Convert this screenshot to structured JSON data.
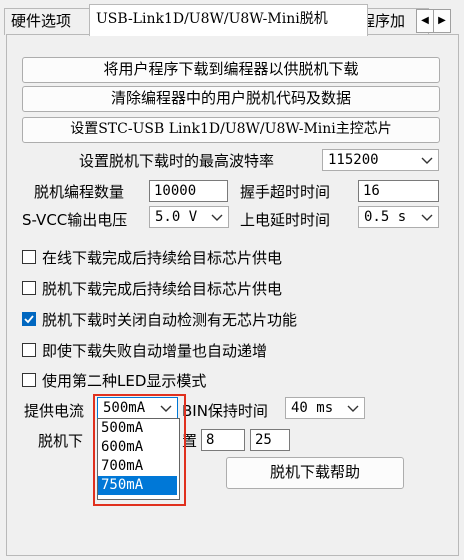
{
  "tabs": [
    {
      "label": "硬件选项"
    },
    {
      "label": "USB-Link1D/U8W/U8W-Mini脱机"
    },
    {
      "label": "程序加"
    }
  ],
  "buttons": {
    "download_to_programmer": "将用户程序下载到编程器以供脱机下载",
    "clear_programmer": "清除编程器中的用户脱机代码及数据",
    "set_master_chip": "设置STC-USB Link1D/U8W/U8W-Mini主控芯片",
    "offline_help": "脱机下载帮助"
  },
  "settings": {
    "max_baud_label": "设置脱机下载时的最高波特率",
    "max_baud_value": "115200",
    "count_label": "脱机编程数量",
    "count_value": "10000",
    "handshake_label": "握手超时时间",
    "handshake_value": "16",
    "svcc_label": "S-VCC输出电压",
    "svcc_value": "5.0 V",
    "poweron_label": "上电延时时间",
    "poweron_value": "0.5 s",
    "current_label": "提供电流",
    "current_value": "500mA",
    "bin_hold_label": "BIN保持时间",
    "bin_hold_value": "40 ms",
    "offline_pos_label_left": "脱机下",
    "offline_pos_label_right": "置",
    "offline_pos_value1": "8",
    "offline_pos_value2": "25"
  },
  "checkboxes": [
    {
      "label": "在线下载完成后持续给目标芯片供电",
      "checked": false
    },
    {
      "label": "脱机下载完成后持续给目标芯片供电",
      "checked": false
    },
    {
      "label": "脱机下载时关闭自动检测有无芯片功能",
      "checked": true
    },
    {
      "label": "即使下载失败自动增量也自动递增",
      "checked": false
    },
    {
      "label": "使用第二种LED显示模式",
      "checked": false
    }
  ],
  "current_options": [
    "500mA",
    "600mA",
    "700mA",
    "750mA"
  ],
  "selected_option_index": 3,
  "colors": {
    "accent": "#0078d7",
    "highlight_box": "#e0301e"
  }
}
